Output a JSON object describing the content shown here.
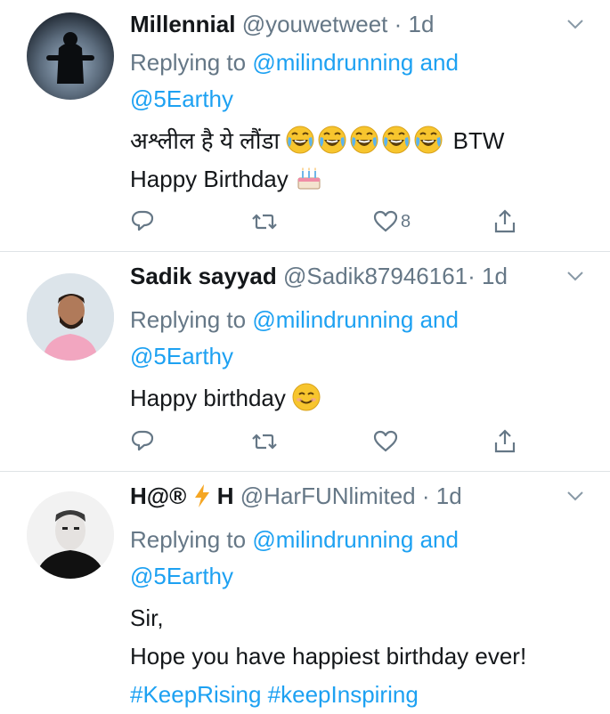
{
  "tweets": [
    {
      "name": "Millennial",
      "handle": "@youwetweet",
      "separator": "·",
      "time": "1d",
      "replying_prefix": "Replying to",
      "mention1": "@milindrunning",
      "and_text": "and",
      "mention2": "@5Earthy",
      "text_line1": "अश्लील है ये लौंडा",
      "text_line1_after": "BTW",
      "text_line2": "Happy Birthday",
      "emoji_icons": [
        "face-with-tears-of-joy",
        "face-with-tears-of-joy",
        "face-with-tears-of-joy",
        "face-with-tears-of-joy",
        "face-with-tears-of-joy",
        "birthday-cake"
      ],
      "like_count": "8"
    },
    {
      "name": "Sadik sayyad",
      "handle": "@Sadik87946161",
      "separator": "·",
      "time": "1d",
      "replying_prefix": "Replying to",
      "mention1": "@milindrunning",
      "and_text": "and",
      "mention2": "@5Earthy",
      "text_line1": "Happy birthday",
      "emoji_icons": [
        "smiling-face-with-smiling-eyes"
      ],
      "like_count": ""
    },
    {
      "name": "H@®",
      "name_suffix": "H",
      "handle": "@HarFUNlimited",
      "separator": "·",
      "time": "1d",
      "replying_prefix": "Replying to",
      "mention1": "@milindrunning",
      "and_text": "and",
      "mention2": "@5Earthy",
      "text_line1": "Sir,",
      "text_line2": "Hope you have happiest birthday ever!",
      "hashtag1": "#KeepRising",
      "hashtag2": "#keepInspiring",
      "name_icon": "lightning-bolt"
    }
  ],
  "colors": {
    "link": "#1da1f2",
    "secondary": "#657786",
    "primary": "#14171a",
    "divider": "#dfe3e6"
  }
}
